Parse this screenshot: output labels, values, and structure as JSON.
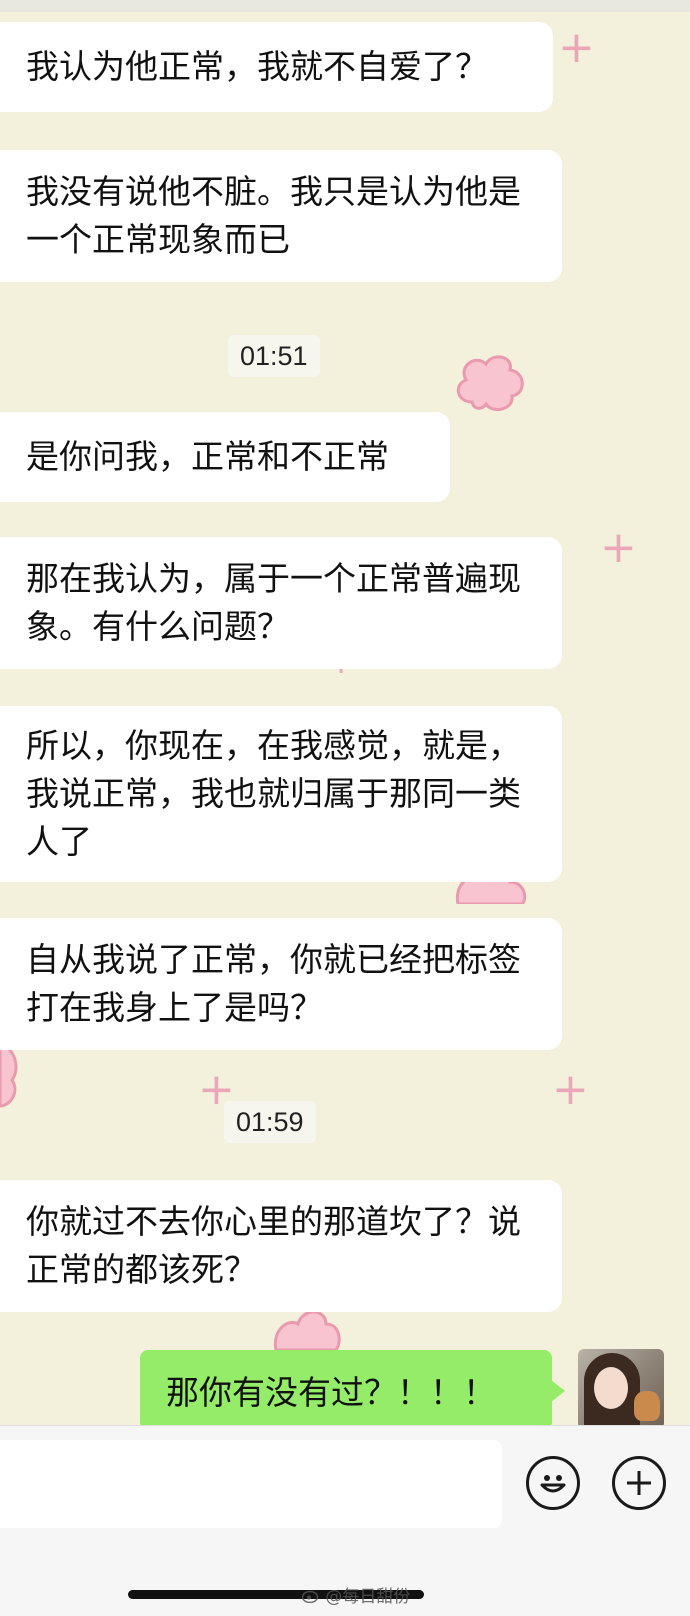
{
  "messages": [
    {
      "text": "我认为他正常，我就不自爱了？"
    },
    {
      "text": "我没有说他不脏。我只是认为他是一个正常现象而已"
    },
    {
      "time": "01:51"
    },
    {
      "text": "是你问我，正常和不正常"
    },
    {
      "text": "那在我认为，属于一个正常普遍现象。有什么问题？"
    },
    {
      "text": "所以，你现在，在我感觉，就是，我说正常，我也就归属于那同一类人了"
    },
    {
      "text": "自从我说了正常，你就已经把标签打在我身上了是吗？"
    },
    {
      "time": "01:59"
    },
    {
      "text": "你就过不去你心里的那道坎了？说正常的都该死？"
    }
  ],
  "self_message": {
    "text": "那你有没有过？！！！"
  },
  "input": {
    "placeholder": ""
  },
  "icons": {
    "emoji": "smile-icon",
    "add": "plus-icon",
    "weibo": "weibo-icon"
  },
  "watermark": "@每日甜份",
  "colors": {
    "background": "#f3f0dc",
    "self_bubble": "#95ec69",
    "other_bubble": "#ffffff",
    "decoration": "#e9a7b8"
  }
}
